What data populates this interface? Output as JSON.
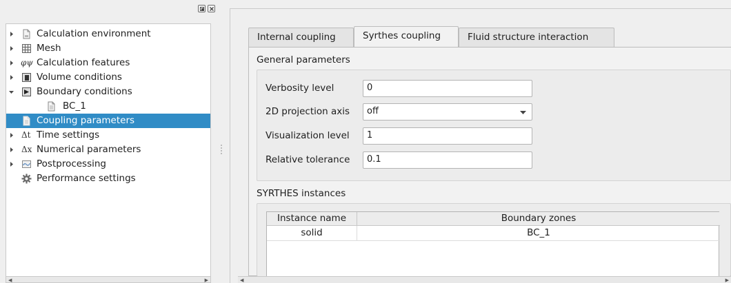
{
  "tree": {
    "items": [
      {
        "label": "Calculation environment",
        "icon": "document-icon",
        "expandable": true
      },
      {
        "label": "Mesh",
        "icon": "mesh-grid-icon",
        "expandable": true
      },
      {
        "label": "Calculation features",
        "prefix": "φψ",
        "icon": "phi-psi-icon",
        "expandable": true
      },
      {
        "label": "Volume conditions",
        "icon": "volume-box-icon",
        "expandable": true
      },
      {
        "label": "Boundary conditions",
        "icon": "boundary-icon",
        "expandable": true,
        "expanded": true
      },
      {
        "label": "BC_1",
        "icon": "document-icon",
        "child": true
      },
      {
        "label": "Coupling parameters",
        "icon": "document-icon",
        "selected": true
      },
      {
        "label": "Time settings",
        "prefix": "Δt",
        "icon": "delta-t-icon",
        "expandable": true
      },
      {
        "label": "Numerical parameters",
        "prefix": "Δx",
        "icon": "delta-x-icon",
        "expandable": true
      },
      {
        "label": "Postprocessing",
        "icon": "chart-icon",
        "expandable": true
      },
      {
        "label": "Performance settings",
        "icon": "gear-icon"
      }
    ],
    "selected_color": "#308cc6"
  },
  "tabs": [
    {
      "label": "Internal coupling"
    },
    {
      "label": "Syrthes coupling",
      "active": true
    },
    {
      "label": "Fluid structure interaction"
    }
  ],
  "general": {
    "title": "General parameters",
    "verbosity_label": "Verbosity level",
    "verbosity_value": "0",
    "projection_label": "2D projection axis",
    "projection_value": "off",
    "visualization_label": "Visualization level",
    "visualization_value": "1",
    "tolerance_label": "Relative tolerance",
    "tolerance_value": "0.1"
  },
  "instances": {
    "title": "SYRTHES instances",
    "columns": [
      "Instance name",
      "Boundary zones"
    ],
    "rows": [
      [
        "solid",
        "BC_1"
      ]
    ]
  }
}
